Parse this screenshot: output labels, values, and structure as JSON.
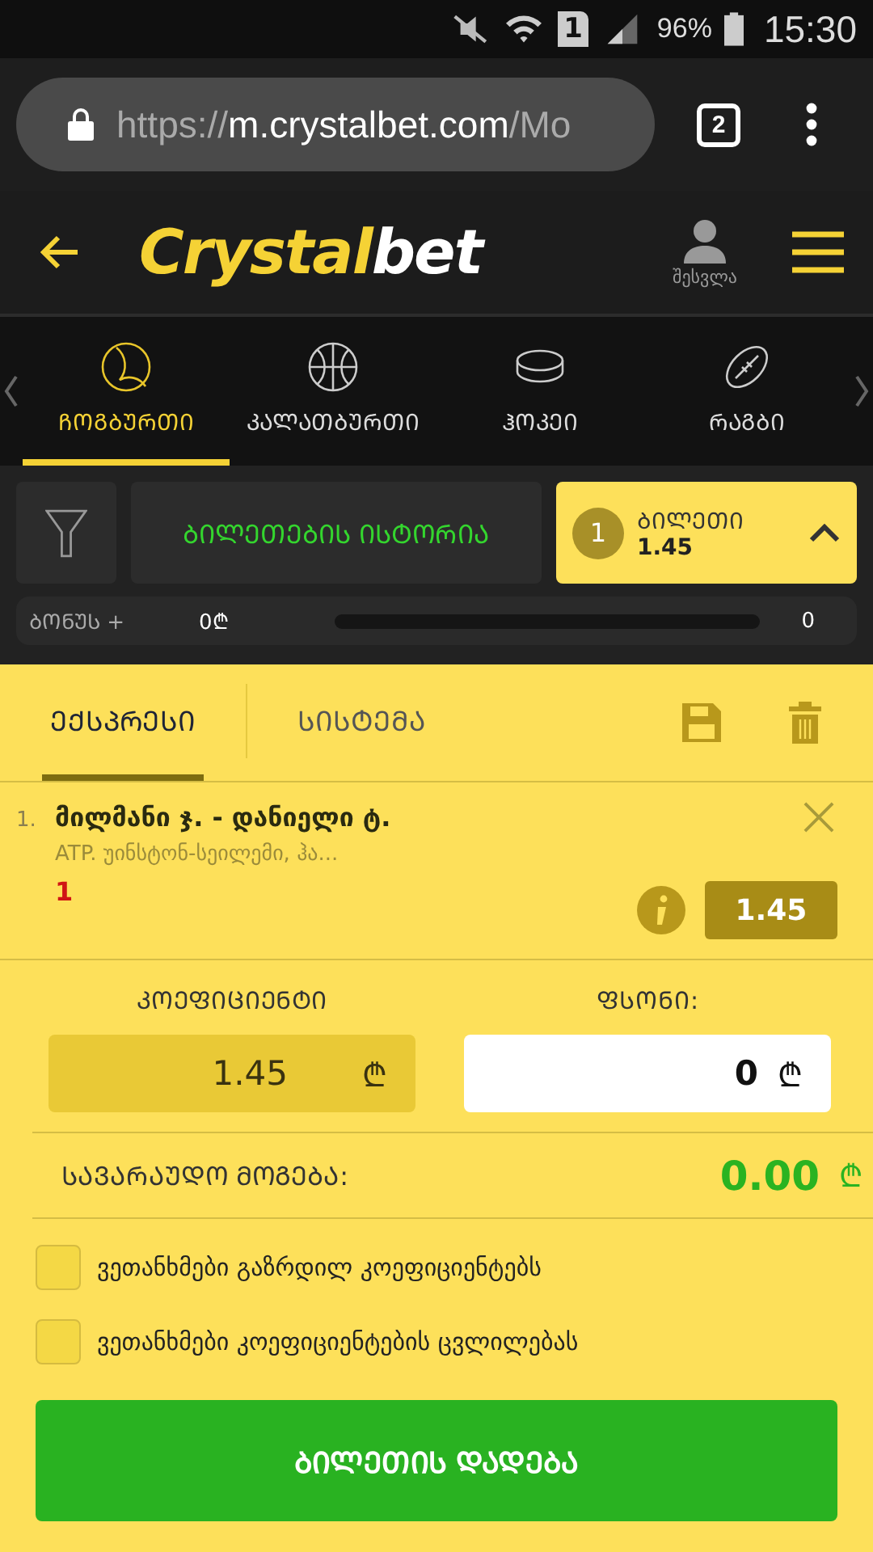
{
  "status_bar": {
    "sim": "1",
    "battery": "96%",
    "time": "15:30"
  },
  "browser": {
    "url_scheme": "https://",
    "url_host": "m.crystalbet.com",
    "url_path": "/Mo",
    "tab_count": "2"
  },
  "header": {
    "logo_main": "Crystal",
    "logo_accent": "bet",
    "login": "შესვლა"
  },
  "sports": [
    {
      "label": "ᲩᲝᲒᲑᲣᲠᲗᲘ",
      "kind": "tennis",
      "selected": true
    },
    {
      "label": "ᲙᲐᲚᲐᲗᲑᲣᲠᲗᲘ",
      "kind": "basketball",
      "selected": false
    },
    {
      "label": "ᲰᲝᲙᲔᲘ",
      "kind": "hockey",
      "selected": false
    },
    {
      "label": "ᲠᲐᲒᲑᲘ",
      "kind": "rugby",
      "selected": false
    }
  ],
  "actions": {
    "history": "ᲑᲘᲚᲔᲗᲔᲑᲘᲡ ᲘᲡᲢᲝᲠᲘᲐ",
    "ticket_count": "1",
    "ticket_label": "ᲑᲘᲚᲔᲗᲘ",
    "ticket_odds": "1.45"
  },
  "bonus": {
    "label": "ᲑᲝᲜᲣᲡ +",
    "amount": "0₾",
    "level": 0,
    "count": "0"
  },
  "slip_tabs": [
    {
      "label": "ᲔᲥᲡᲞᲠᲔᲡᲘ",
      "selected": true
    },
    {
      "label": "ᲡᲘᲡᲢᲔᲛᲐ",
      "selected": false
    }
  ],
  "bets": [
    {
      "number": "1.",
      "match": "მილმანი ჯ. - დანიელი ტ.",
      "event": "ATP. უინსტონ-სეილემი, ჰა...",
      "pick": "1",
      "odds": "1.45"
    }
  ],
  "odds_field": {
    "label": "ᲙᲝᲔᲤᲘᲪᲘᲔᲜᲢᲘ",
    "value": "1.45",
    "currency": "₾"
  },
  "stake_field": {
    "label": "ᲤᲡᲝᲜᲘ:",
    "value": "0",
    "currency": "₾"
  },
  "win": {
    "label": "ᲡᲐᲕᲐᲠᲐᲣᲓᲝ ᲛᲝᲒᲔᲑᲐ:",
    "value": "0.00",
    "currency": "₾"
  },
  "agreements": [
    {
      "label": "ვეთანხმები გაზრდილ კოეფიციენტებს",
      "checked": false
    },
    {
      "label": "ვეთანხმები კოეფიციენტების ცვლილებას",
      "checked": false
    }
  ],
  "submit": "ᲑᲘᲚᲔᲗᲘᲡ ᲓᲐᲓᲔᲑᲐ"
}
